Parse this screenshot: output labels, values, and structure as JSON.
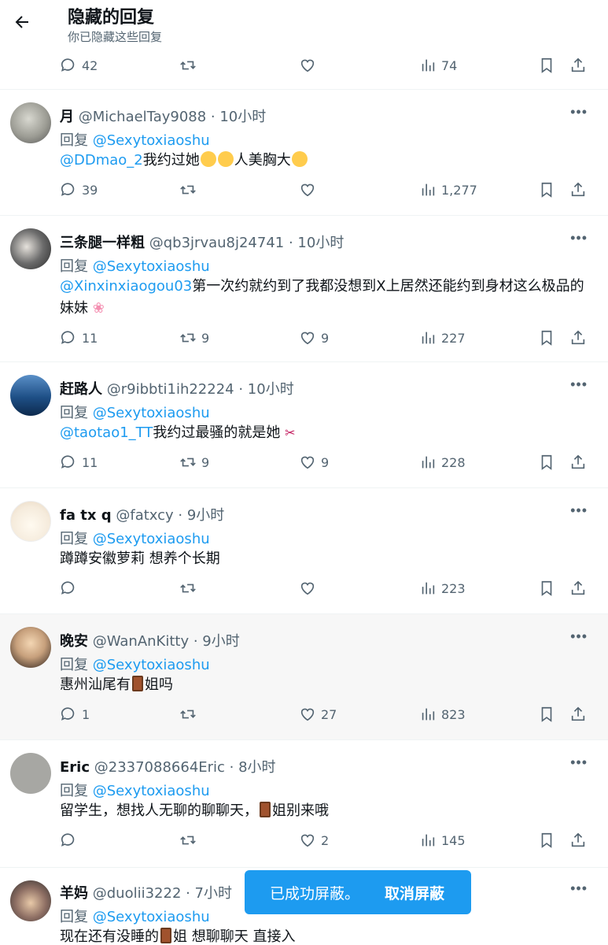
{
  "header": {
    "title": "隐藏的回复",
    "subtitle": "你已隐藏这些回复"
  },
  "top_actions": {
    "reply_count": "42",
    "view_count": "74"
  },
  "tweets": [
    {
      "name": "月",
      "handle": "@MichaelTay9088 · 10小时",
      "reply_label": "回复",
      "reply_to": "@Sexytoxiaoshu",
      "mention": "@DDmao_2",
      "text": "我约过她",
      "text2": "人美胸大",
      "reply_count": "39",
      "retweet_count": "",
      "like_count": "",
      "view_count": "1,277"
    },
    {
      "name": "三条腿一样粗",
      "handle": "@qb3jrvau8j24741 · 10小时",
      "reply_label": "回复",
      "reply_to": "@Sexytoxiaoshu",
      "mention": "@Xinxinxiaogou03",
      "text": "第一次约就约到了我都没想到X上居然还能约到身材这么极品的妹妹",
      "reply_count": "11",
      "retweet_count": "9",
      "like_count": "9",
      "view_count": "227"
    },
    {
      "name": "赶路人",
      "handle": "@r9ibbti1ih22224 · 10小时",
      "reply_label": "回复",
      "reply_to": "@Sexytoxiaoshu",
      "mention": "@taotao1_TT",
      "text": "我约过最骚的就是她",
      "reply_count": "11",
      "retweet_count": "9",
      "like_count": "9",
      "view_count": "228"
    },
    {
      "name": "fa tx q",
      "handle": "@fatxcy · 9小时",
      "reply_label": "回复",
      "reply_to": "@Sexytoxiaoshu",
      "mention": "",
      "text": "蹲蹲安徽萝莉 想养个长期",
      "reply_count": "",
      "retweet_count": "",
      "like_count": "",
      "view_count": "223"
    },
    {
      "name": "晚安",
      "handle": "@WanAnKitty · 9小时",
      "reply_label": "回复",
      "reply_to": "@Sexytoxiaoshu",
      "mention": "",
      "text": "惠州汕尾有",
      "text2": "姐吗",
      "reply_count": "1",
      "retweet_count": "",
      "like_count": "27",
      "view_count": "823"
    },
    {
      "name": "Eric",
      "handle": "@2337088664Eric · 8小时",
      "reply_label": "回复",
      "reply_to": "@Sexytoxiaoshu",
      "mention": "",
      "text": "留学生，想找人无聊的聊聊天，",
      "text2": "姐别来哦",
      "reply_count": "",
      "retweet_count": "",
      "like_count": "2",
      "view_count": "145"
    },
    {
      "name": "羊妈",
      "handle": "@duolii3222 · 7小时",
      "reply_label": "回复",
      "reply_to": "@Sexytoxiaoshu",
      "mention": "",
      "text": "现在还有没睡的",
      "text2": "姐 想聊聊天 直接入"
    }
  ],
  "toast": {
    "message": "已成功屏蔽。",
    "undo": "取消屏蔽"
  },
  "colors": {
    "accent": "#1d9bf0",
    "muted": "#536471",
    "text": "#0f1419"
  }
}
